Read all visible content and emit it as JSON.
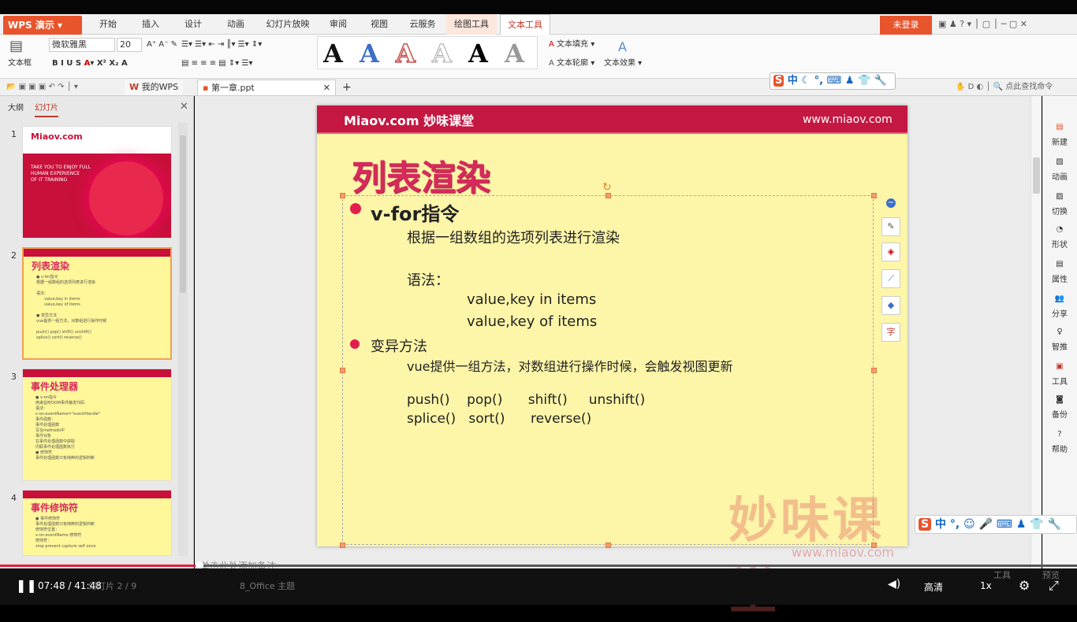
{
  "app": {
    "name": "WPS 演示",
    "login": "未登录"
  },
  "menu": [
    "开始",
    "插入",
    "设计",
    "动画",
    "幻灯片放映",
    "审阅",
    "视图",
    "云服务",
    "绘图工具",
    "文本工具"
  ],
  "ribbon": {
    "textbox": "文本框",
    "font": "微软雅黑",
    "size": "20",
    "text_fill": "文本填充",
    "text_outline": "文本轮廓",
    "text_effect": "文本效果",
    "style_letter": "A"
  },
  "tabs": {
    "my_wps": "我的WPS",
    "file": "第一章.ppt",
    "search": "点此查找命令"
  },
  "panel": {
    "outline": "大纲",
    "slides": "幻灯片"
  },
  "thumbs": [
    {
      "num": "1",
      "brand": "Miaov.com",
      "tag1": "TAKE YOU TO ENJOY FULL",
      "tag2": "HUMAN EXPERIENCE",
      "tag3": "OF IT TRAINING"
    },
    {
      "num": "2",
      "title": "列表渲染"
    },
    {
      "num": "3",
      "title": "事件处理器"
    },
    {
      "num": "4",
      "title": "事件修饰符"
    }
  ],
  "slide": {
    "logo": "Miaov.com 妙味课堂",
    "url": "www.miaov.com",
    "title": "列表渲染",
    "b1": "v-for指令",
    "b1_line": "根据一组数组的选项列表进行渲染",
    "syntax": "语法：",
    "syntax1": "value,key in items",
    "syntax2": "value,key of items",
    "b2": "变异方法",
    "b2_line": "vue提供一组方法，对数组进行操作时候，会触发视图更新",
    "m1": "push()    pop()      shift()     unshift()",
    "m2": "splice()   sort()      reverse()",
    "watermark": "妙味课堂",
    "watermark_url": "www.miaov.com",
    "float_char": "字"
  },
  "right_panel": [
    "新建",
    "动画",
    "切换",
    "形状",
    "属性",
    "分享",
    "智推",
    "工具",
    "备份",
    "帮助"
  ],
  "status": {
    "slide": "幻灯片 2 / 9",
    "theme": "8_Office 主题",
    "notes": "单击此处添加备注",
    "tool": "工具",
    "preview": "预览"
  },
  "player": {
    "time": "07:48 / 41:48",
    "quality": "高清",
    "speed": "1x"
  },
  "ime": {
    "lang": "中"
  },
  "colors": {
    "accent": "#e8542c",
    "slide_bg": "#fdf5a8",
    "title_red": "#d62a5c",
    "header": "#c41843"
  }
}
